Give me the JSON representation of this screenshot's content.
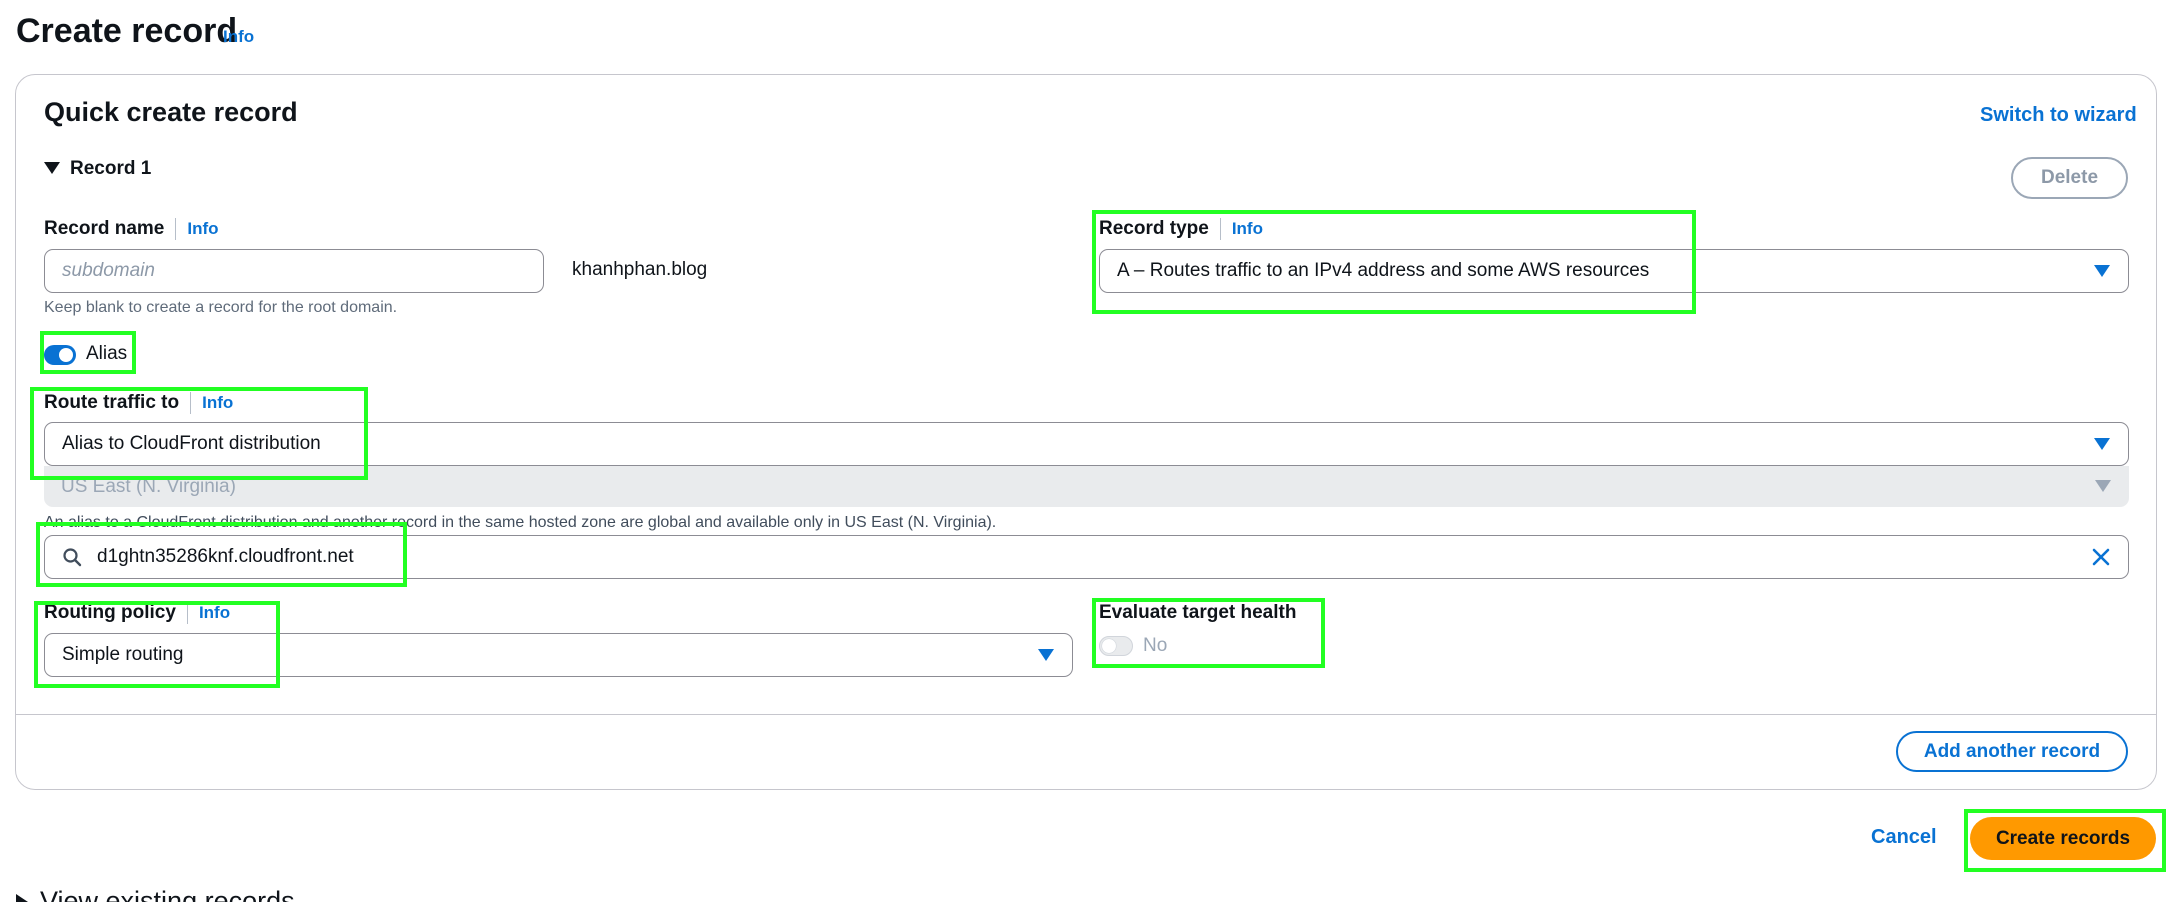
{
  "header": {
    "title": "Create record",
    "info_label": "Info"
  },
  "panel": {
    "title": "Quick create record",
    "switch_wizard_label": "Switch to wizard",
    "record_section_label": "Record 1",
    "delete_label": "Delete",
    "add_another_label": "Add another record"
  },
  "record_name": {
    "label": "Record name",
    "info_label": "Info",
    "placeholder": "subdomain",
    "value": "",
    "domain_suffix": "khanhphan.blog",
    "hint": "Keep blank to create a record for the root domain."
  },
  "record_type": {
    "label": "Record type",
    "info_label": "Info",
    "value": "A – Routes traffic to an IPv4 address and some AWS resources"
  },
  "alias": {
    "label": "Alias",
    "enabled": true
  },
  "route_traffic": {
    "label": "Route traffic to",
    "info_label": "Info",
    "endpoint_value": "Alias to CloudFront distribution",
    "region_value": "US East (N. Virginia)",
    "hint": "An alias to a CloudFront distribution and another record in the same hosted zone are global and available only in US East (N. Virginia).",
    "distribution_value": "d1ghtn35286knf.cloudfront.net"
  },
  "routing_policy": {
    "label": "Routing policy",
    "info_label": "Info",
    "value": "Simple routing"
  },
  "evaluate_health": {
    "label": "Evaluate target health",
    "value": "No",
    "enabled": false
  },
  "footer": {
    "cancel_label": "Cancel",
    "create_label": "Create records",
    "view_existing_label": "View existing records"
  },
  "colors": {
    "link_blue": "#0972d3",
    "primary_orange": "#ff9900",
    "highlight_green": "#22ff22"
  }
}
